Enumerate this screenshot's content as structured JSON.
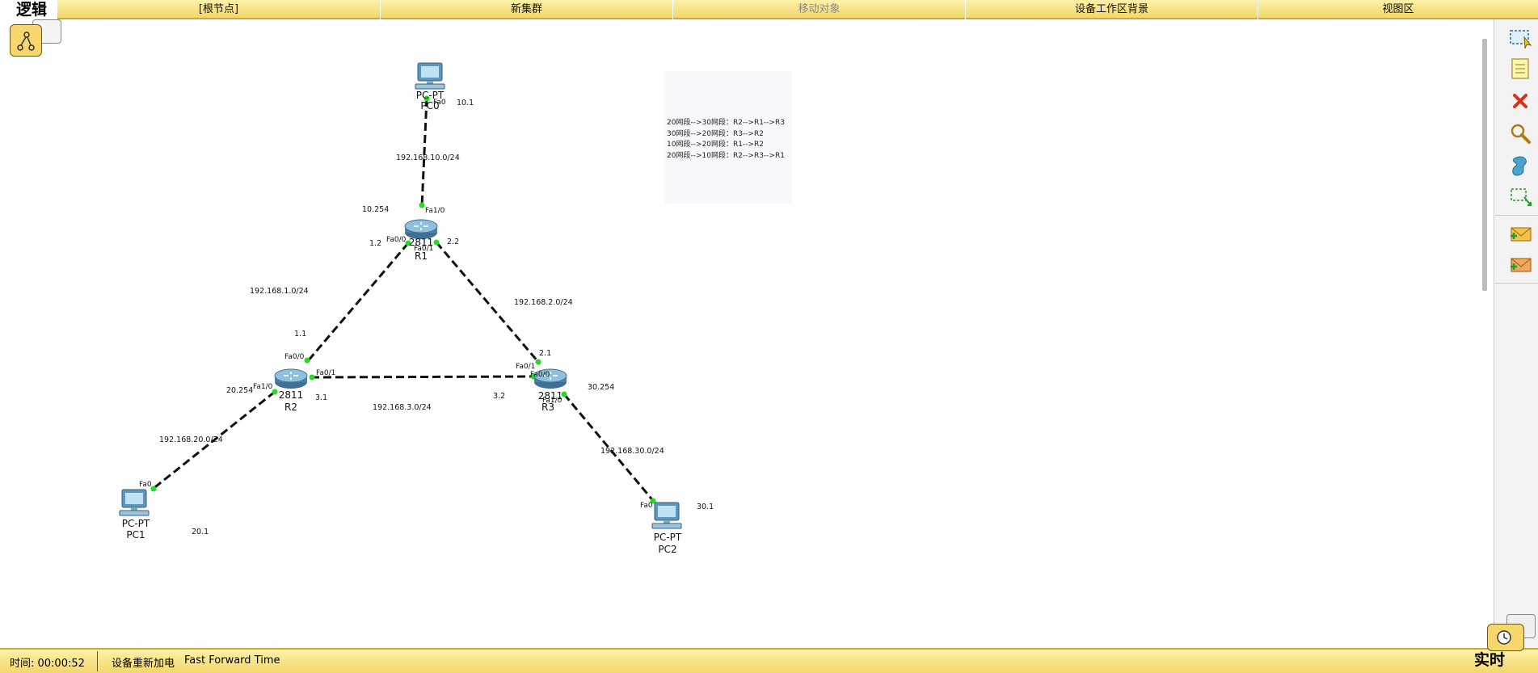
{
  "topbar": {
    "mode": "逻辑",
    "items": [
      {
        "label": "[根节点]",
        "enabled": true
      },
      {
        "label": "新集群",
        "enabled": true
      },
      {
        "label": "移动对象",
        "enabled": false
      },
      {
        "label": "设备工作区背景",
        "enabled": true
      },
      {
        "label": "视图区",
        "enabled": true
      }
    ]
  },
  "topology": {
    "devices": {
      "pc0": {
        "type": "PC-PT",
        "name": "PC0"
      },
      "pc1": {
        "type": "PC-PT",
        "name": "PC1"
      },
      "pc2": {
        "type": "PC-PT",
        "name": "PC2"
      },
      "r1": {
        "model": "2811",
        "name": "R1"
      },
      "r2": {
        "model": "2811",
        "name": "R2"
      },
      "r3": {
        "model": "2811",
        "name": "R3"
      }
    },
    "ports": {
      "pc0_fa0": "Fa0",
      "r1_fa10": "Fa1/0",
      "r1_fa00": "Fa0/0",
      "r1_fa01": "Fa0/1",
      "r2_fa00": "Fa0/0",
      "r2_fa01": "Fa0/1",
      "r2_fa10": "Fa1/0",
      "r3_fa01": "Fa0/1",
      "r3_fa00": "Fa0/0",
      "r3_fa10": "Fa1/0",
      "pc1_fa0": "Fa0",
      "pc2_fa0": "Fa0"
    },
    "networks": {
      "n10": "192.168.10.0/24",
      "n1": "192.168.1.0/24",
      "n2": "192.168.2.0/24",
      "n3": "192.168.3.0/24",
      "n20": "192.168.20.0/24",
      "n30": "192.168.30.0/24"
    },
    "addresses": {
      "pc0": "10.1",
      "r1_fa10": "10.254",
      "r1_fa00": "1.2",
      "r1_fa01": "2.2",
      "r2_fa00": "1.1",
      "r2_fa10": "20.254",
      "r2_fa01": "3.1",
      "r3_fa00": "3.2",
      "r3_fa01": "2.1",
      "r3_fa10": "30.254",
      "pc1": "20.1",
      "pc2": "30.1"
    }
  },
  "note": [
    "20网段-->30网段：R2-->R1-->R3",
    "30网段-->20网段：R3-->R2",
    "10网段-->20网段：R1-->R2",
    "20网段-->10网段：R2-->R3-->R1"
  ],
  "sidebar_tools": [
    "select-icon",
    "note-icon",
    "delete-icon",
    "inspect-icon",
    "draw-shape-icon",
    "resize-icon",
    "add-simple-pdu-icon",
    "add-complex-pdu-icon"
  ],
  "status": {
    "time_label": "时间: 00:00:52",
    "power_cycle": "设备重新加电",
    "fast_forward": "Fast Forward Time",
    "mode": "实时"
  },
  "colors": {
    "bar": "#f7df7a",
    "link_light": "#22dd22",
    "router": "#5a8fb5"
  }
}
